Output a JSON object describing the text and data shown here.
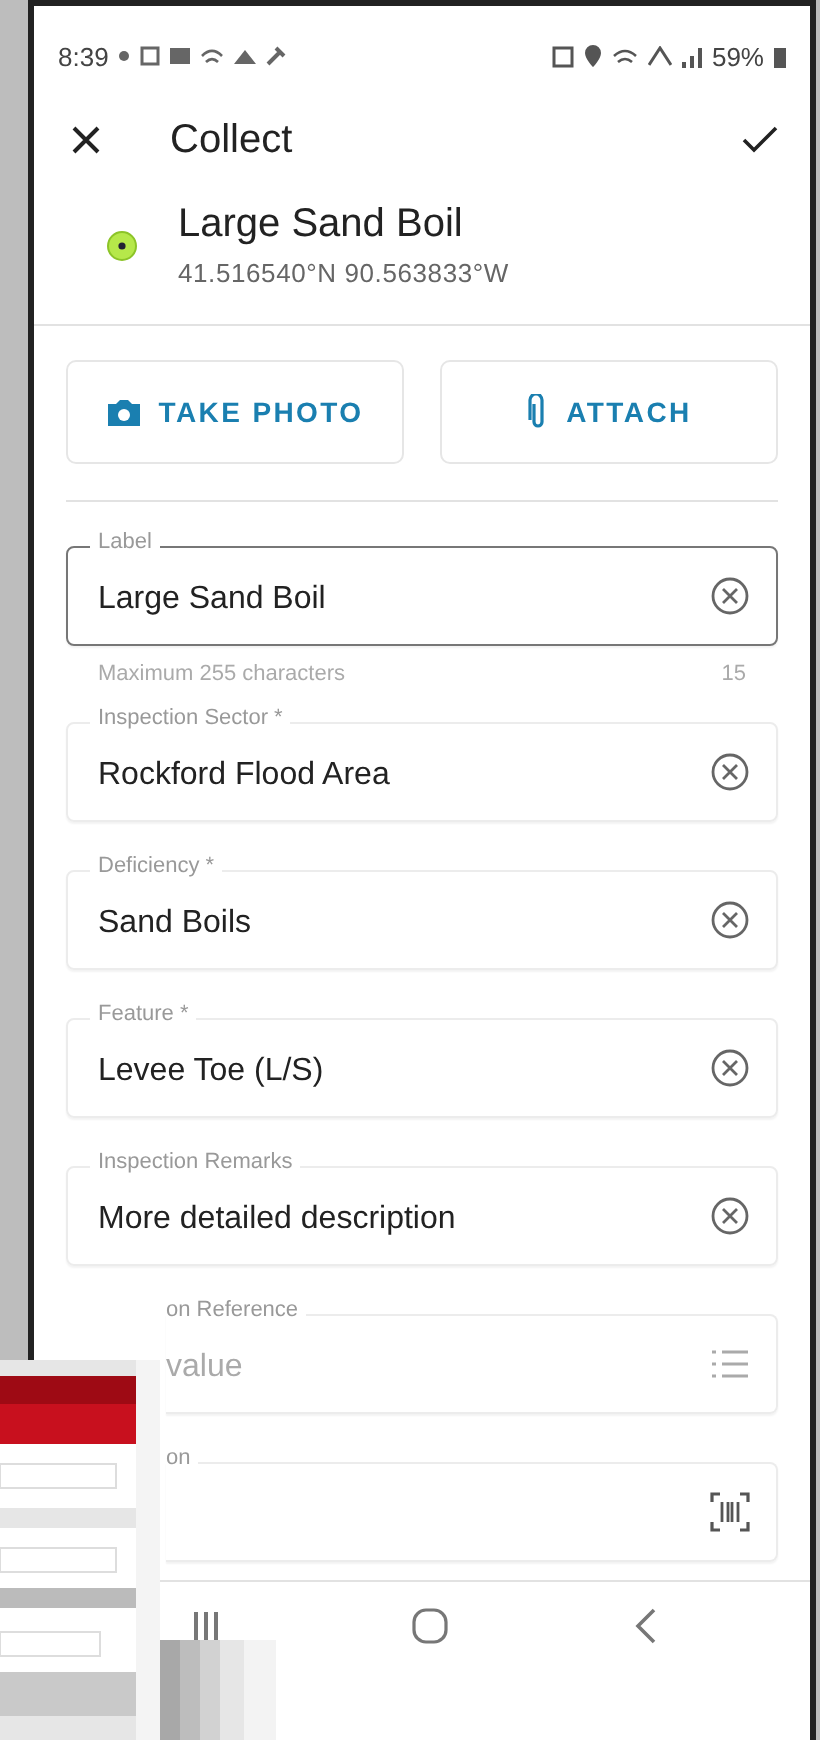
{
  "status_bar": {
    "time": "8:39",
    "battery": "59%"
  },
  "app_bar": {
    "title": "Collect"
  },
  "feature": {
    "name": "Large Sand Boil",
    "coordinates": "41.516540°N  90.563833°W"
  },
  "actions": [
    {
      "label": "TAKE PHOTO",
      "kind": "camera"
    },
    {
      "label": "ATTACH",
      "kind": "attach"
    }
  ],
  "fields": [
    {
      "label": "Label",
      "value": "Large Sand Boil",
      "kind": "clear",
      "selected": true,
      "helper": "Maximum 255 characters",
      "count": "15"
    },
    {
      "label": "Inspection Sector *",
      "value": "Rockford Flood Area",
      "kind": "clear",
      "selected": false
    },
    {
      "label": "Deficiency *",
      "value": "Sand Boils",
      "kind": "clear",
      "selected": false
    },
    {
      "label": "Feature *",
      "value": "Levee Toe (L/S)",
      "kind": "clear",
      "selected": false
    },
    {
      "label": "Inspection Remarks",
      "value": "More detailed description",
      "kind": "clear",
      "selected": false
    },
    {
      "label": "on Reference",
      "placeholder": "value",
      "kind": "list",
      "selected": false,
      "covered": true
    },
    {
      "label": "on",
      "kind": "barcode",
      "selected": false,
      "covered": true
    }
  ]
}
